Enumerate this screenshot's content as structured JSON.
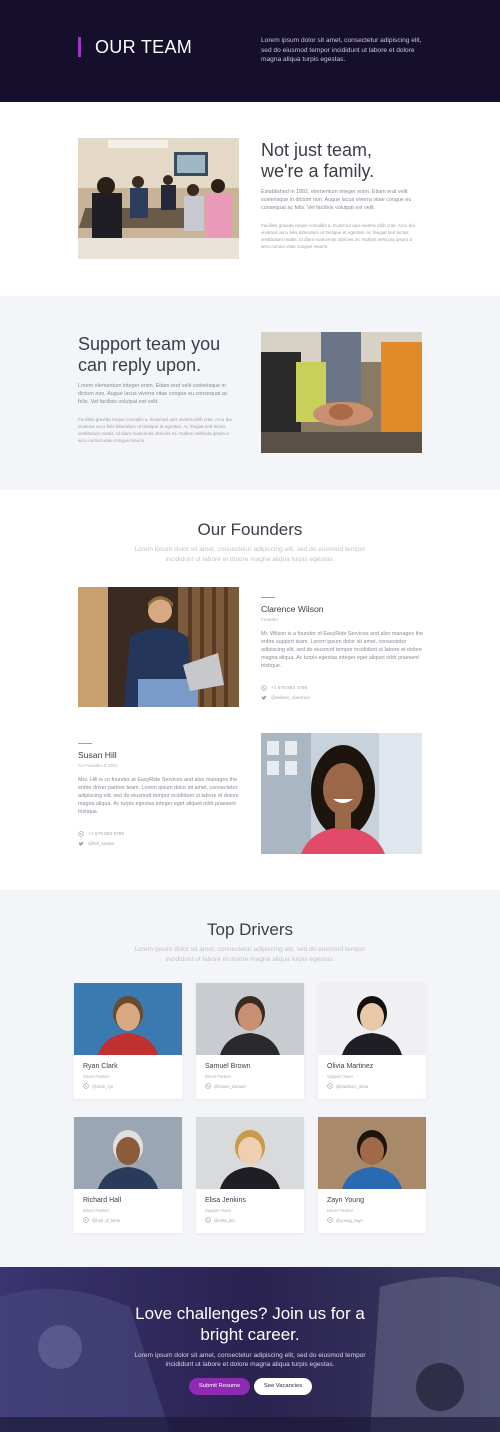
{
  "hero": {
    "title": "OUR TEAM",
    "text": "Lorem ipsum dolor sit amet, consectetur adipiscing elit, sed do eiusmod tempor incididunt ut labore et dolore magna aliqua turpis egestas."
  },
  "about": {
    "heading_line1": "Not just team,",
    "heading_line2": "we're a family.",
    "para1": "Established in 1992, elementum integer enim. Etiam erat velit scelerisque in dictum non. Augue lacus viverra vitae congue eu consequat ac felis. Vel facilisis volutpat est velit.",
    "para2": "Facilisis gravida neque convallis a. Euismod quis viverra nibh cras. Arcu dui vivamus arcu felis bibendum ut tristique et egestas. Ac feugiat sed lectus vestibulum mattis. Id diam maecenas ultricies mi. Nullam vehicula ipsum a arcu cursus vitae congue mauris."
  },
  "support": {
    "heading_line1": "Support team you",
    "heading_line2": "can reply upon.",
    "para1": "Lorem elementum integer enim. Etiam erat velit scelerisque in dictum non. Augue lacus viverra vitae congue eu consequat ac felis. Vel facilisis volutpat est velit.",
    "para2": "Facilisis gravida neque convallis a. Euismod quis viverra nibh cras. Arcu dui vivamus arcu felis bibendum ut tristique et egestas. Ac feugiat sed lectus vestibulum mattis. Id diam maecenas ultricies mi. Nullam vehicula ipsum a arcu cursus vitae congue mauris."
  },
  "founders": {
    "title": "Our Founders",
    "subtitle": "Lorem ipsum dolor sit amet, consectetur adipiscing elit, sed do eiusmod tempor incididunt ut labore et dolore magna aliqua turpis egestas.",
    "people": [
      {
        "name": "Clarence Wilson",
        "role": "Founder",
        "bio": "Mr. Wilson is a founder of EasyRide Services and also manages the entire support team. Lorem ipsum dolor sit amet, consectetur adipiscing elit, sed do eiusmod tempor incididunt ut labore et dolore magna aliqua. Ac turpis egestas integer eget aliquet nibh praesent tristique.",
        "phone": "+1 579 883 4756",
        "twitter": "@wilson_clarence"
      },
      {
        "name": "Susan Hill",
        "role": "Co Founder & CEO",
        "bio": "Mrs. Hill is co founder at EasyRide Services and also manages the entire driver partner team. Lorem ipsum dolor sit amet, consectetur adipiscing elit, sed do eiusmod tempor incididunt ut labore et dolore magna aliqua. Ac turpis egestas integer eget aliquet nibh praesent tristique.",
        "phone": "+1 579 883 6795",
        "twitter": "@hill_susan"
      }
    ]
  },
  "drivers": {
    "title": "Top Drivers",
    "subtitle": "Lorem ipsum dolor sit amet, consectetur adipiscing elit, sed do eiusmod tempor incididunt ut labore et dolore magna aliqua turpis egestas.",
    "people": [
      {
        "name": "Ryan Clark",
        "role": "Driver Partner",
        "handle": "@clark_ryn"
      },
      {
        "name": "Samuel Brown",
        "role": "Driver Partner",
        "handle": "@brown_samuel"
      },
      {
        "name": "Olivia Martinez",
        "role": "Support Team",
        "handle": "@martinez_olivia"
      },
      {
        "name": "Richard Hall",
        "role": "Driver Partner",
        "handle": "@hall_of_fame"
      },
      {
        "name": "Elisa Jenkins",
        "role": "Support Team",
        "handle": "@elisa_jen"
      },
      {
        "name": "Zayn Young",
        "role": "Driver Partner",
        "handle": "@young_zayn"
      }
    ]
  },
  "cta": {
    "heading_line1": "Love challenges? Join us for a",
    "heading_line2": "bright career.",
    "text": "Lorem ipsum dolor sit amet, consectetur adipiscing elit, sed do eiusmod tempor incididunt ut labore et dolore magna aliqua turpis egestas.",
    "primary_label": "Submit Resume",
    "secondary_label": "See Vacancies"
  },
  "colors": {
    "hero_bg": "#150f2c",
    "accent": "#a534c8",
    "section_alt_bg": "#f4f5f8",
    "cta_button": "#8f2bb3"
  },
  "icons": {
    "phone": "whatsapp-icon",
    "twitter": "twitter-icon"
  }
}
